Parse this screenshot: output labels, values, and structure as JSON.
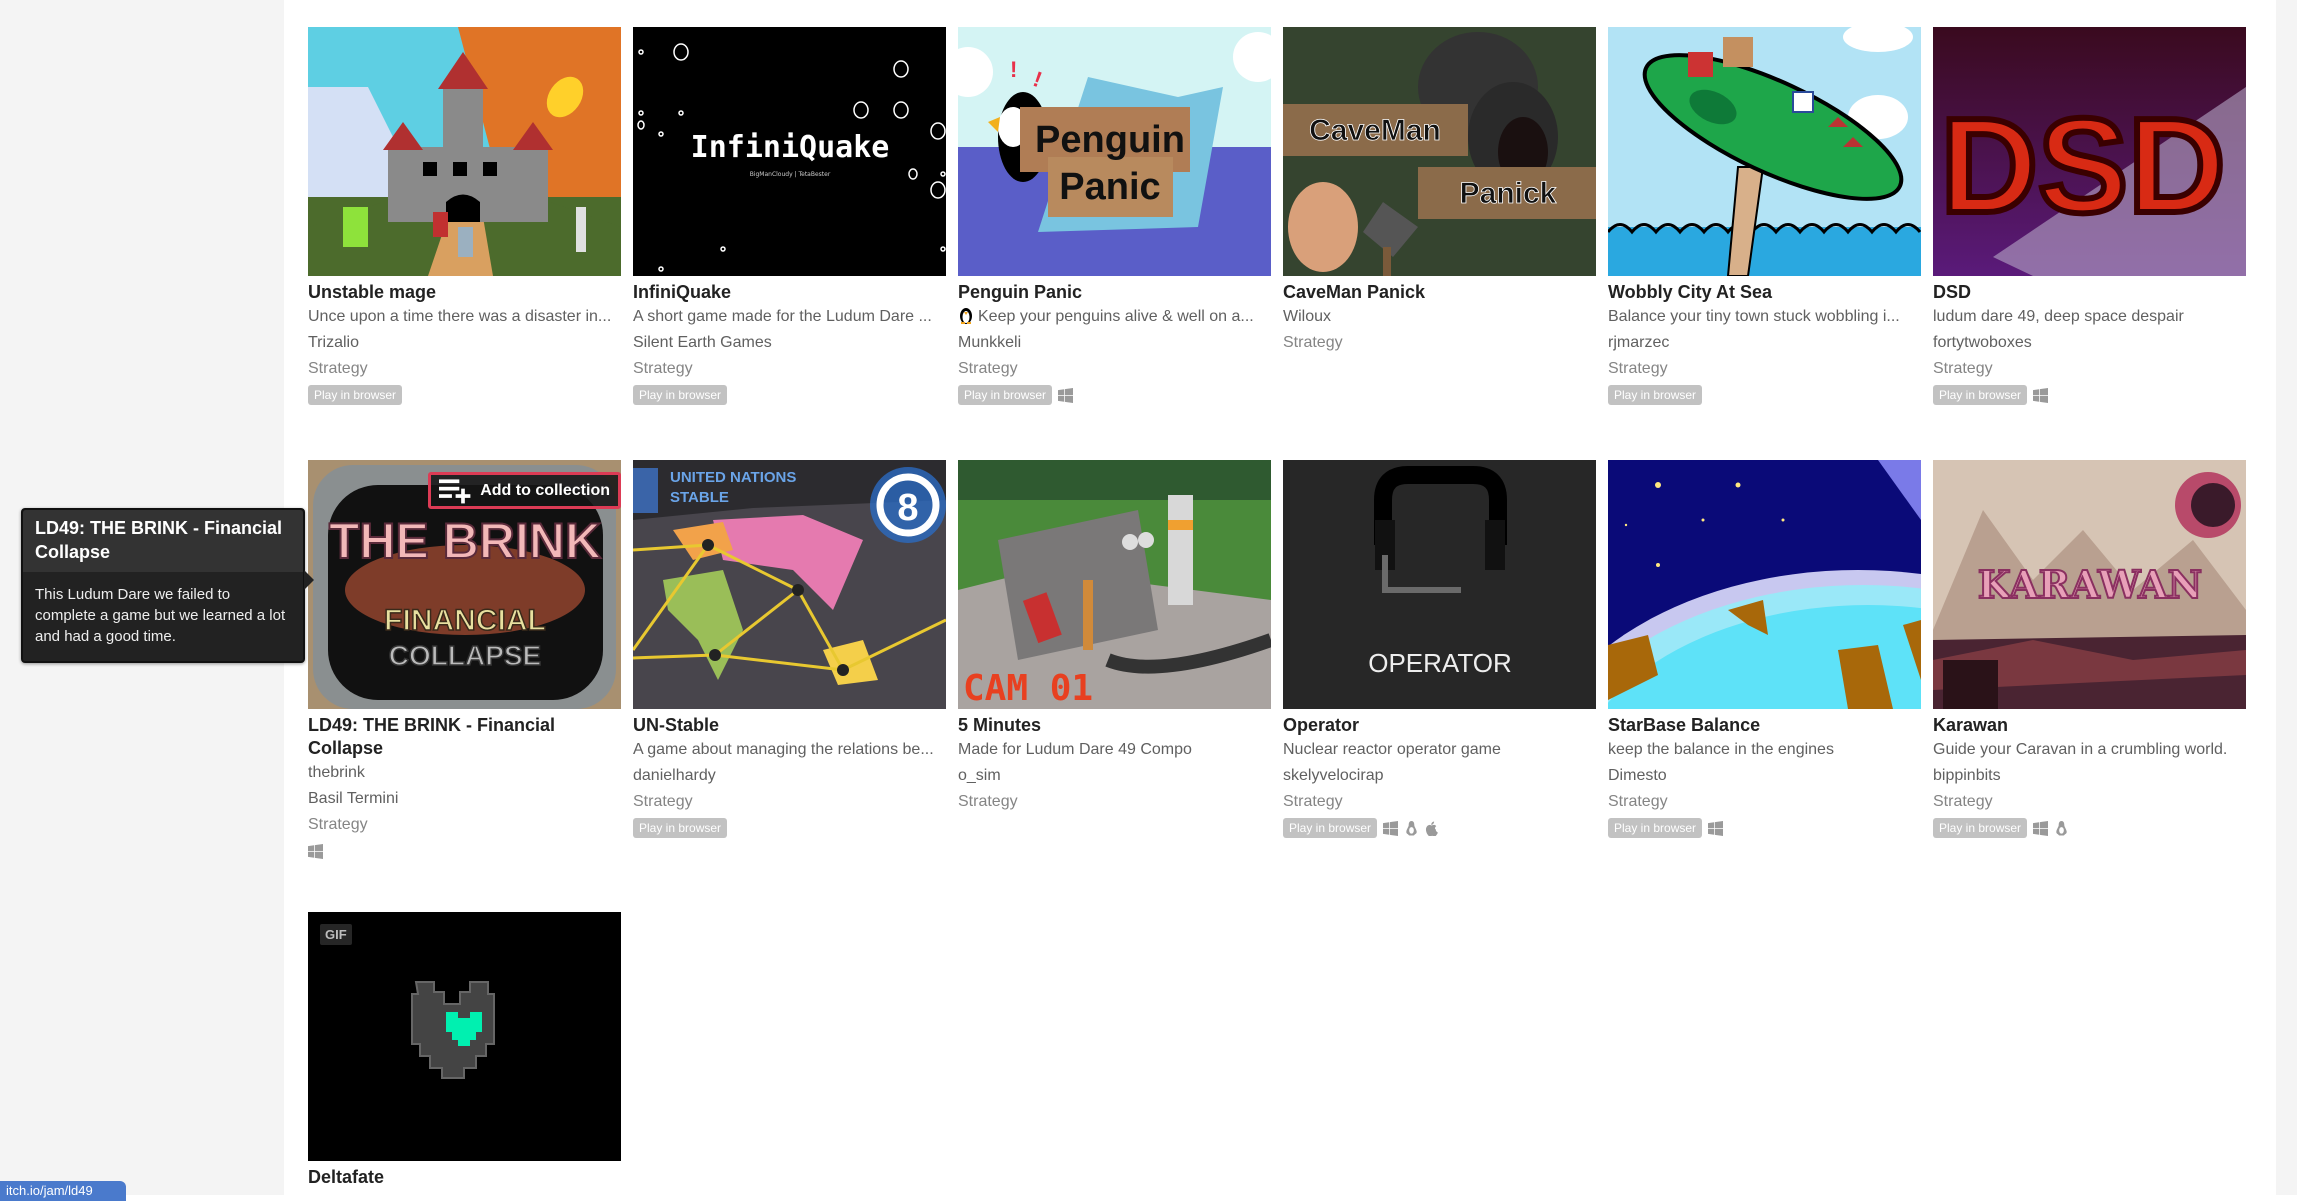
{
  "status_bar": {
    "url": "itch.io/jam/ld49"
  },
  "tooltip": {
    "title": "LD49: THE BRINK - Financial Collapse",
    "description": "This Ludum Dare we failed to complete a game but we learned a lot and had a good time."
  },
  "hover_action": {
    "label": "Add to collection",
    "icon": "playlist-add-icon"
  },
  "badges": {
    "play_in_browser": "Play in browser",
    "gif": "GIF"
  },
  "games": [
    {
      "title": "Unstable mage",
      "description": "Unce upon a time there was a disaster in...",
      "authors": [
        "Trizalio"
      ],
      "genre": "Strategy",
      "browser": true,
      "platforms": []
    },
    {
      "title": "InfiniQuake",
      "description": "A short game made for the Ludum Dare ...",
      "authors": [
        "Silent Earth Games"
      ],
      "genre": "Strategy",
      "browser": true,
      "platforms": [],
      "thumb_text": "InfiniQuake",
      "thumb_subtext": "BigManCloudy | TetaBester"
    },
    {
      "title": "Penguin Panic",
      "description": "Keep your penguins alive & well on a...",
      "description_icon": "penguin-emoji",
      "authors": [
        "Munkkeli"
      ],
      "genre": "Strategy",
      "browser": true,
      "platforms": [
        "windows"
      ],
      "thumb_text": [
        "Penguin",
        "Panic"
      ]
    },
    {
      "title": "CaveMan Panick",
      "description": "",
      "authors": [
        "Wiloux"
      ],
      "genre": "Strategy",
      "browser": false,
      "platforms": [],
      "thumb_text": [
        "CaveMan",
        "Panick"
      ]
    },
    {
      "title": "Wobbly City At Sea",
      "description": "Balance your tiny town stuck wobbling i...",
      "authors": [
        "rjmarzec"
      ],
      "genre": "Strategy",
      "browser": true,
      "platforms": []
    },
    {
      "title": "DSD",
      "description": "ludum dare 49, deep space despair",
      "authors": [
        "fortytwoboxes"
      ],
      "genre": "Strategy",
      "browser": true,
      "platforms": [
        "windows"
      ],
      "thumb_text": "DSD"
    },
    {
      "title": "LD49: THE BRINK - Financial Collapse",
      "description": "",
      "authors": [
        "thebrink",
        "Basil Termini"
      ],
      "genre": "Strategy",
      "browser": false,
      "platforms": [
        "windows"
      ],
      "thumb_text": [
        "THE BRINK",
        "FINANCIAL",
        "COLLAPSE"
      ]
    },
    {
      "title": "UN-Stable",
      "description": "A game about managing the relations be...",
      "authors": [
        "danielhardy"
      ],
      "genre": "Strategy",
      "browser": true,
      "platforms": [],
      "thumb_text": [
        "UNITED NATIONS",
        "STABLE",
        "8"
      ]
    },
    {
      "title": "5 Minutes",
      "description": "Made for Ludum Dare 49 Compo",
      "authors": [
        "o_sim"
      ],
      "genre": "Strategy",
      "browser": false,
      "platforms": [],
      "thumb_text": "CAM 01"
    },
    {
      "title": "Operator",
      "description": "Nuclear reactor operator game",
      "authors": [
        "skelyvelocirap"
      ],
      "genre": "Strategy",
      "browser": true,
      "platforms": [
        "windows",
        "linux",
        "macos"
      ],
      "thumb_text": "OPERATOR"
    },
    {
      "title": "StarBase Balance",
      "description": "keep the balance in the engines",
      "authors": [
        "Dimesto"
      ],
      "genre": "Strategy",
      "browser": true,
      "platforms": [
        "windows"
      ]
    },
    {
      "title": "Karawan",
      "description": "Guide your Caravan in a crumbling world.",
      "authors": [
        "bippinbits"
      ],
      "genre": "Strategy",
      "browser": true,
      "platforms": [
        "windows",
        "linux"
      ],
      "thumb_text": "KARAWAN"
    },
    {
      "title": "Deltafate",
      "description": "",
      "authors": [],
      "genre": "",
      "browser": false,
      "platforms": [],
      "gif": true
    }
  ]
}
